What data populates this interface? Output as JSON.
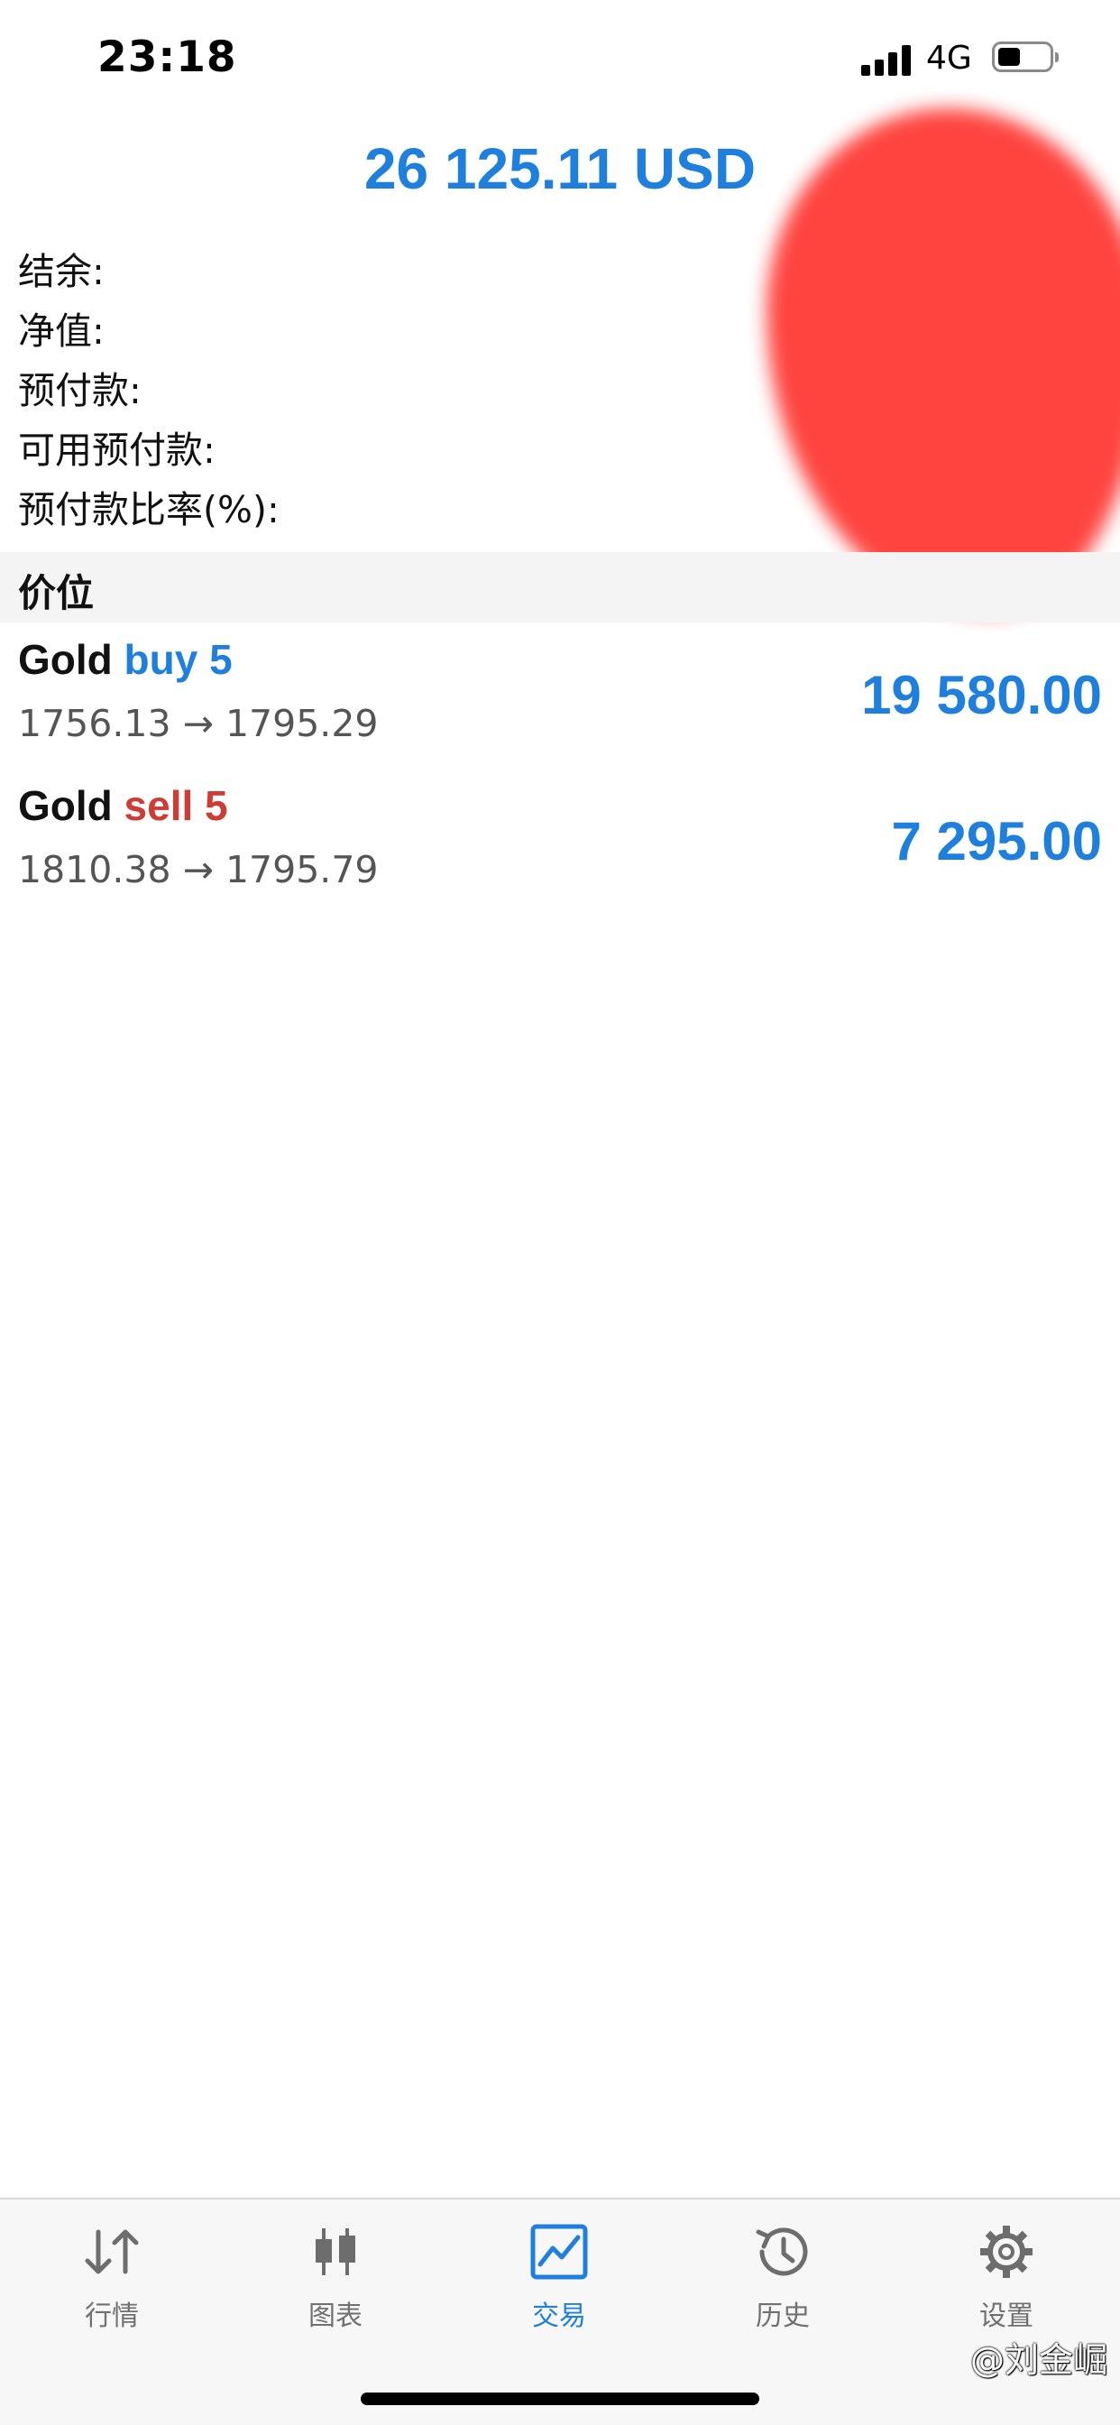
{
  "status_bar": {
    "time": "23:18",
    "network": "4G"
  },
  "balance_header": "26 125.11 USD",
  "summary": [
    {
      "label": "结余:",
      "value": ""
    },
    {
      "label": "净值:",
      "value": ""
    },
    {
      "label": "预付款:",
      "value": ""
    },
    {
      "label": "可用预付款:",
      "value": ""
    },
    {
      "label": "预付款比率(%):",
      "value": ""
    }
  ],
  "section_title": "价位",
  "positions": [
    {
      "symbol": "Gold",
      "side": "buy 5",
      "prices": "1756.13 → 1795.29",
      "profit": "19 580.00"
    },
    {
      "symbol": "Gold",
      "side": "sell 5",
      "prices": "1810.38 → 1795.79",
      "profit": "7 295.00"
    }
  ],
  "tabs": [
    {
      "label": "行情",
      "icon": "arrows-up-down-icon"
    },
    {
      "label": "图表",
      "icon": "candlestick-icon"
    },
    {
      "label": "交易",
      "icon": "trade-chart-icon",
      "active": true
    },
    {
      "label": "历史",
      "icon": "history-clock-icon"
    },
    {
      "label": "设置",
      "icon": "gear-icon"
    }
  ],
  "watermark": "@刘金崛",
  "colors": {
    "accent_blue": "#1f7fdc",
    "sell_red": "#cf3b35",
    "redaction": "#ff3b36"
  }
}
